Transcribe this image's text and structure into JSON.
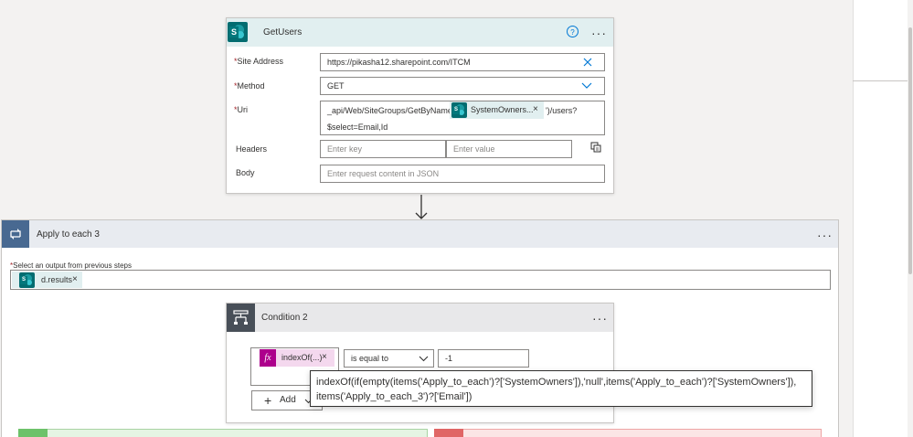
{
  "getusers": {
    "title": "GetUsers",
    "help_icon": "question-circle-icon",
    "fields": {
      "site_label": "Site Address",
      "site_value": "https://pikasha12.sharepoint.com/ITCM",
      "method_label": "Method",
      "method_value": "GET",
      "uri_label": "Uri",
      "uri_prefix": "_api/Web/SiteGroups/GetByName('",
      "uri_token": "SystemOwners...",
      "uri_suffix": "')/users?",
      "uri_line2": "$select=Email,Id",
      "headers_label": "Headers",
      "key_placeholder": "Enter key",
      "value_placeholder": "Enter value",
      "body_label": "Body",
      "body_placeholder": "Enter request content in JSON"
    }
  },
  "apply": {
    "title": "Apply to each 3",
    "select_label": "Select an output from previous steps",
    "token": "d.results"
  },
  "condition": {
    "title": "Condition 2",
    "expr_token": "indexOf(...)",
    "fx": "fx",
    "operator": "is equal to",
    "value": "-1",
    "add_label": "Add",
    "tooltip_line1": "indexOf(if(empty(items('Apply_to_each')?['SystemOwners']),'null',items('Apply_to_each')?['SystemOwners']),",
    "tooltip_line2": "items('Apply_to_each_3')?['Email'])"
  },
  "glyphs": {
    "close": "×",
    "ellipsis": "···",
    "help": "?",
    "plus": "+",
    "required": "*"
  },
  "colors": {
    "sharepoint_teal": "#036c70",
    "header_tint": "#e1eff0",
    "apply_accent": "#486991",
    "condition_accent": "#484f58",
    "expression_purple": "#ad008c",
    "link_blue": "#0078d4"
  }
}
